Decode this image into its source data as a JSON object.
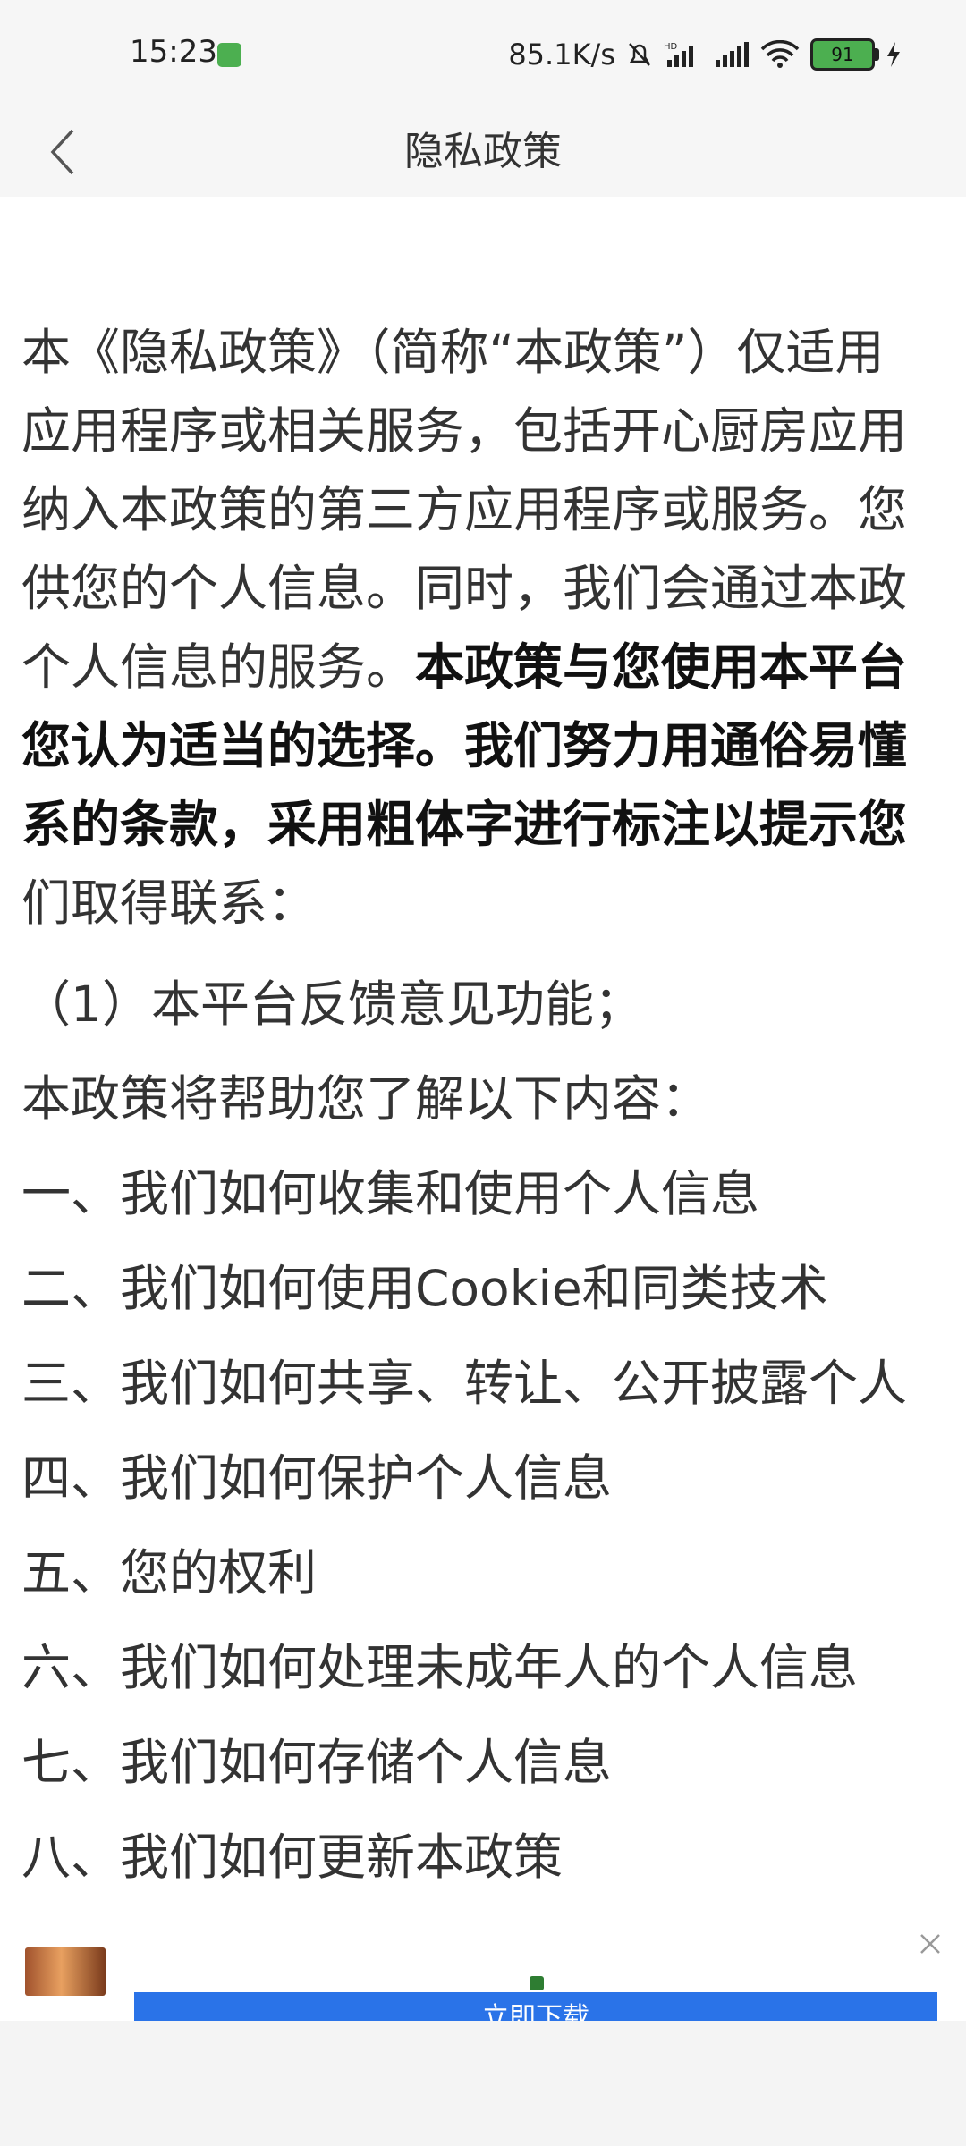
{
  "status_bar": {
    "time": "15:23",
    "network_speed": "85.1K/s",
    "battery_level": "91",
    "icons": [
      "silent-bell-icon",
      "hd-signal-icon",
      "signal-icon",
      "wifi-icon",
      "battery-icon",
      "charging-icon"
    ]
  },
  "header": {
    "title": "隐私政策",
    "back_icon": "chevron-left-icon"
  },
  "intro_lines": [
    {
      "text": "本《隐私政策》（简称“本政策”）仅适用",
      "bold": false
    },
    {
      "text": "应用程序或相关服务，包括开心厨房应用",
      "bold": false
    },
    {
      "text": "纳入本政策的第三方应用程序或服务。您",
      "bold": false
    },
    {
      "text": "供您的个人信息。同时，我们会通过本政",
      "bold": false
    }
  ],
  "intro_mixed_line": {
    "normal": "个人信息的服务。",
    "bold": "本政策与您使用本平台"
  },
  "intro_bold_lines": [
    "您认为适当的选择。我们努力用通俗易懂",
    "系的条款，采用粗体字进行标注以提示您"
  ],
  "intro_tail": "们取得联系：",
  "feedback_item": "（1）本平台反馈意见功能；",
  "toc_intro": "本政策将帮助您了解以下内容：",
  "toc_items": [
    "一、我们如何收集和使用个人信息",
    "二、我们如何使用Cookie和同类技术",
    "三、我们如何共享、转让、公开披露个人",
    "四、我们如何保护个人信息",
    "五、您的权利",
    "六、我们如何处理未成年人的个人信息",
    "七、我们如何存储个人信息",
    "八、我们如何更新本政策"
  ],
  "ad": {
    "download_label": "立即下载",
    "close_icon": "close-icon"
  },
  "colors": {
    "header_bg": "#f6f6f6",
    "text": "#333333",
    "ad_button": "#2a73e8",
    "battery": "#4caf50"
  }
}
